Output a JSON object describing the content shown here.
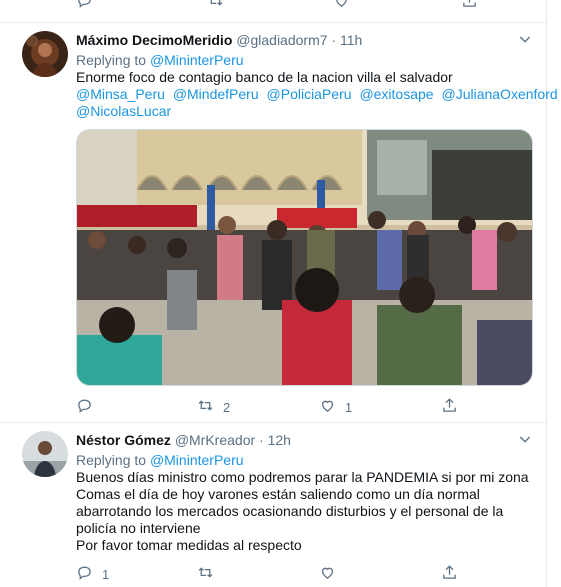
{
  "tweets": [
    {
      "name": "Máximo DecimoMeridio",
      "handle": "@gladiadorm7",
      "time": "11h",
      "replying_prefix": "Replying to",
      "replying_to": "@MininterPeru",
      "text_lines": [
        "Enorme foco de contagio banco de la nacion villa el salvador"
      ],
      "mentions": [
        "@Minsa_Peru",
        "@MindefPeru",
        "@PoliciaPeru",
        "@exitosape",
        "@JulianaOxenford",
        "@NicolasLucar"
      ],
      "media_alt": "Crowd of people queuing outside a bank building",
      "reply_count": "",
      "retweet_count": "2",
      "like_count": "1"
    },
    {
      "name": "Néstor Gómez",
      "handle": "@MrKreador",
      "time": "12h",
      "replying_prefix": "Replying to",
      "replying_to": "@MininterPeru",
      "text_lines": [
        "Buenos días ministro como podremos parar la PANDEMIA si por mi zona",
        "Comas el día de hoy varones están saliendo como un día normal",
        "abarrotando los mercados ocasionando disturbios y el personal de la",
        "policía no interviene",
        "Por favor tomar medidas al respecto"
      ],
      "reply_count": "1",
      "retweet_count": "",
      "like_count": ""
    }
  ],
  "colors": {
    "link": "#1b95e0",
    "secondary": "#5b7083",
    "border": "#e6ecf0"
  },
  "icons": [
    "reply-icon",
    "retweet-icon",
    "like-icon",
    "share-icon",
    "chevron-down-icon"
  ]
}
